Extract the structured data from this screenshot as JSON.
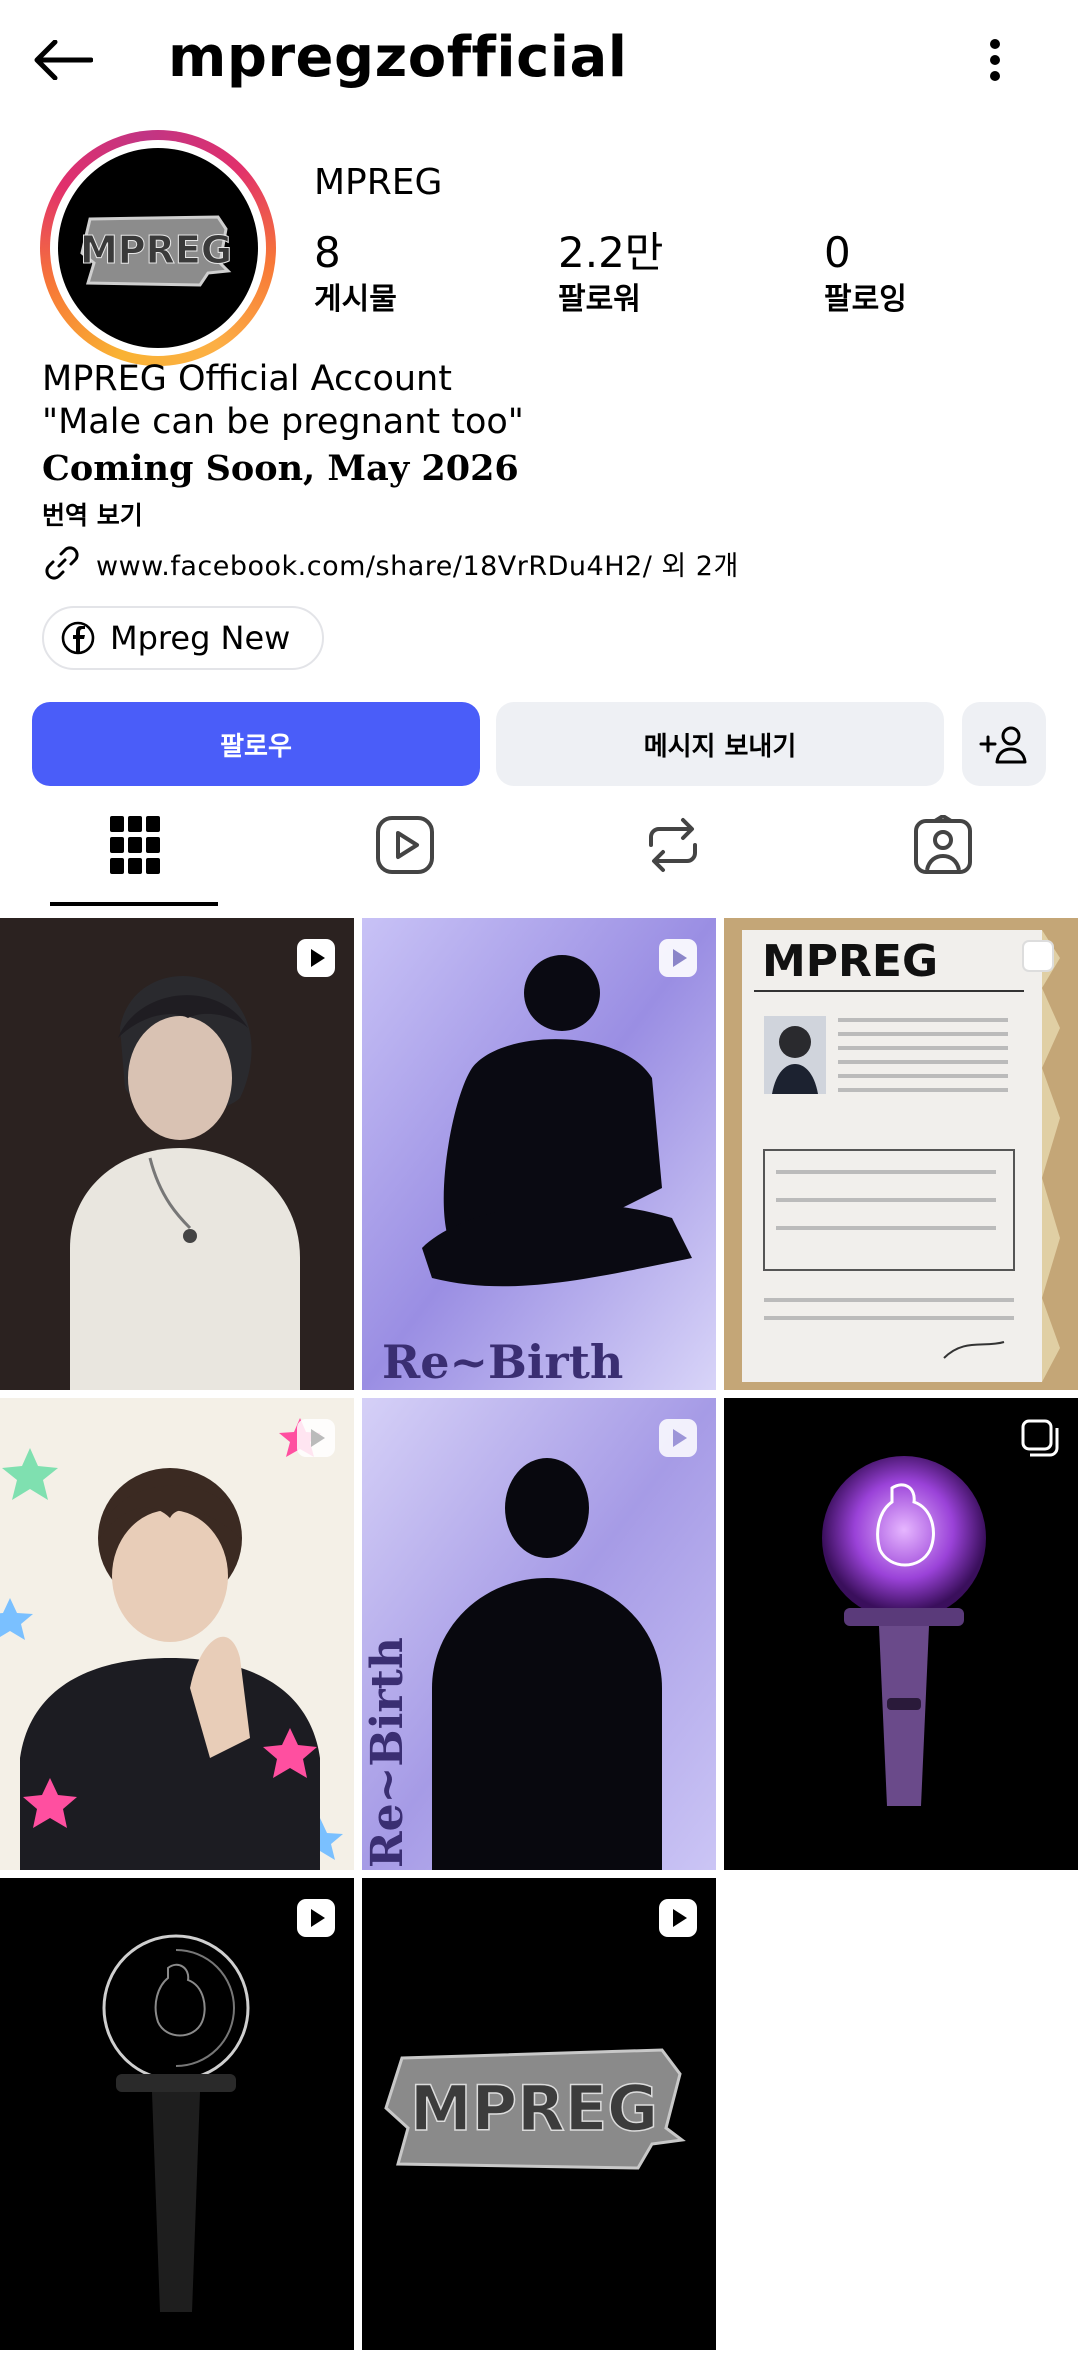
{
  "header": {
    "username": "mpregzofficial"
  },
  "profile": {
    "avatar_logo_text": "MPREG",
    "display_name": "MPREG",
    "stats": [
      {
        "value": "8",
        "label": "게시물"
      },
      {
        "value": "2.2만",
        "label": "팔로워"
      },
      {
        "value": "0",
        "label": "팔로잉"
      }
    ],
    "bio_line1": "MPREG Official Account",
    "bio_line2": "\"Male can be pregnant too\"",
    "bio_line3": "Coming Soon, May 2026",
    "translate_label": "번역 보기",
    "link_text": "www.facebook.com/share/18VrRDu4H2/ 외 2개",
    "facebook_chip": "Mpreg New"
  },
  "actions": {
    "follow_label": "팔로우",
    "message_label": "메시지 보내기"
  },
  "tabs": [
    "posts",
    "reels",
    "reposts",
    "tagged"
  ],
  "posts": [
    {
      "type": "reel"
    },
    {
      "type": "reel",
      "caption": "Re~Birth"
    },
    {
      "type": "carousel",
      "card_title": "MPREG"
    },
    {
      "type": "reel"
    },
    {
      "type": "reel",
      "caption": "Re~Birth"
    },
    {
      "type": "carousel"
    },
    {
      "type": "reel"
    },
    {
      "type": "reel",
      "logo_text": "MPREG"
    }
  ],
  "colors": {
    "follow_button": "#4a5df9",
    "secondary_button": "#eef0f4"
  }
}
